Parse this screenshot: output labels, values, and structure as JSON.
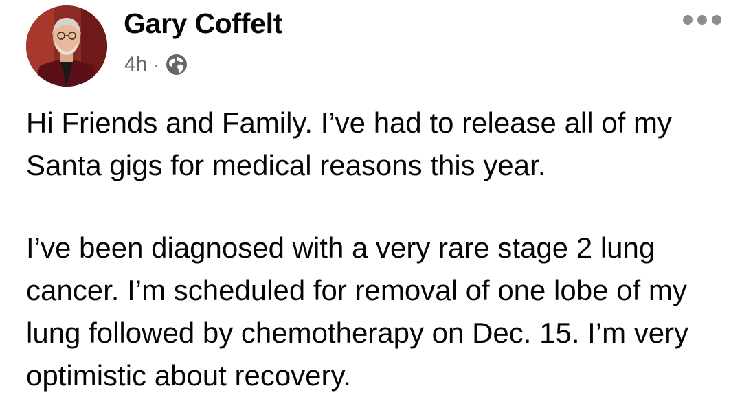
{
  "post": {
    "author_name": "Gary Coffelt",
    "timestamp": "4h",
    "separator": "·",
    "privacy_icon": "globe-icon",
    "more_icon": "more-options-icon",
    "paragraphs": [
      "Hi Friends and Family. I’ve had to release all of my Santa gigs for medical reasons this year.",
      "I’ve been diagnosed with a very rare stage 2 lung cancer. I’m scheduled for removal of one lobe of my lung followed by chemotherapy on Dec. 15. I’m very optimistic about recovery."
    ]
  },
  "colors": {
    "text_primary": "#050505",
    "text_secondary": "#65676b",
    "icon_gray": "#8a8d91",
    "avatar_background": "#7a1e1e"
  }
}
